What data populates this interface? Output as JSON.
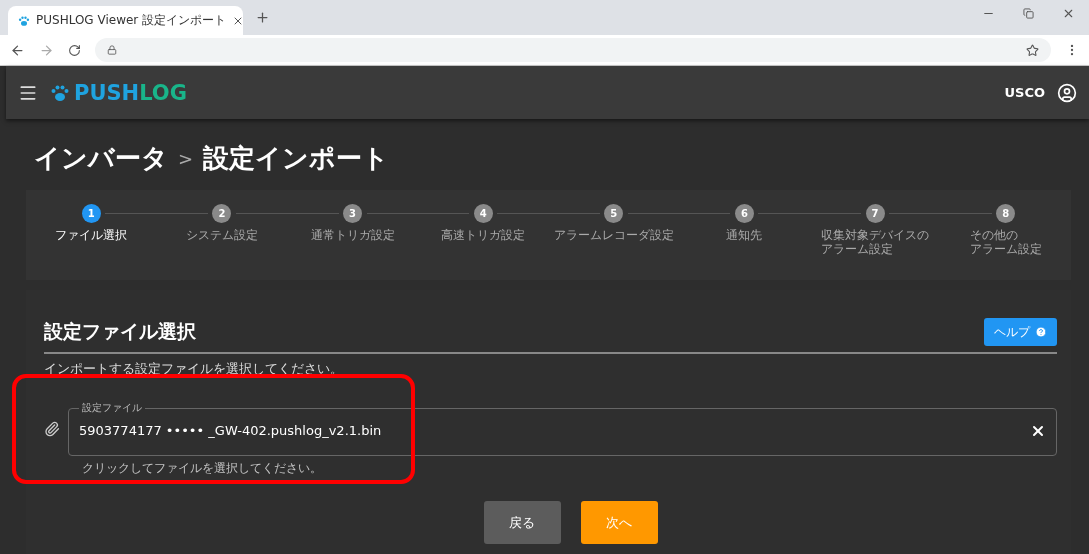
{
  "browser": {
    "tab_title": "PUSHLOG Viewer 設定インポート"
  },
  "header": {
    "logo_a": "PUSH",
    "logo_b": "LOG",
    "user": "USCO"
  },
  "breadcrumb": [
    "インバータ",
    "設定インポート"
  ],
  "breadcrumb_sep": ">",
  "steps": [
    {
      "number": "1",
      "lines": [
        "ファイル選択"
      ],
      "selected": true
    },
    {
      "number": "2",
      "lines": [
        "システム設定"
      ],
      "selected": false
    },
    {
      "number": "3",
      "lines": [
        "通常トリガ設定"
      ],
      "selected": false
    },
    {
      "number": "4",
      "lines": [
        "高速トリガ設定"
      ],
      "selected": false
    },
    {
      "number": "5",
      "lines": [
        "アラームレコーダ設定"
      ],
      "selected": false
    },
    {
      "number": "6",
      "lines": [
        "通知先"
      ],
      "selected": false
    },
    {
      "number": "7",
      "lines": [
        "収集対象デバイスの",
        "アラーム設定"
      ],
      "selected": false
    },
    {
      "number": "8",
      "lines": [
        "その他の",
        "アラーム設定"
      ],
      "selected": false
    }
  ],
  "section": {
    "title": "設定ファイル選択",
    "help": "ヘルプ",
    "description": "インポートする設定ファイルを選択してください。"
  },
  "file_field": {
    "label": "設定ファイル",
    "value": "5903774177 ••••• _GW-402.pushlog_v2.1.bin",
    "hint": "クリックしてファイルを選択してください。",
    "highlighted": true
  },
  "buttons": [
    {
      "label": "戻る",
      "kind": "back"
    },
    {
      "label": "次へ",
      "kind": "next"
    }
  ]
}
